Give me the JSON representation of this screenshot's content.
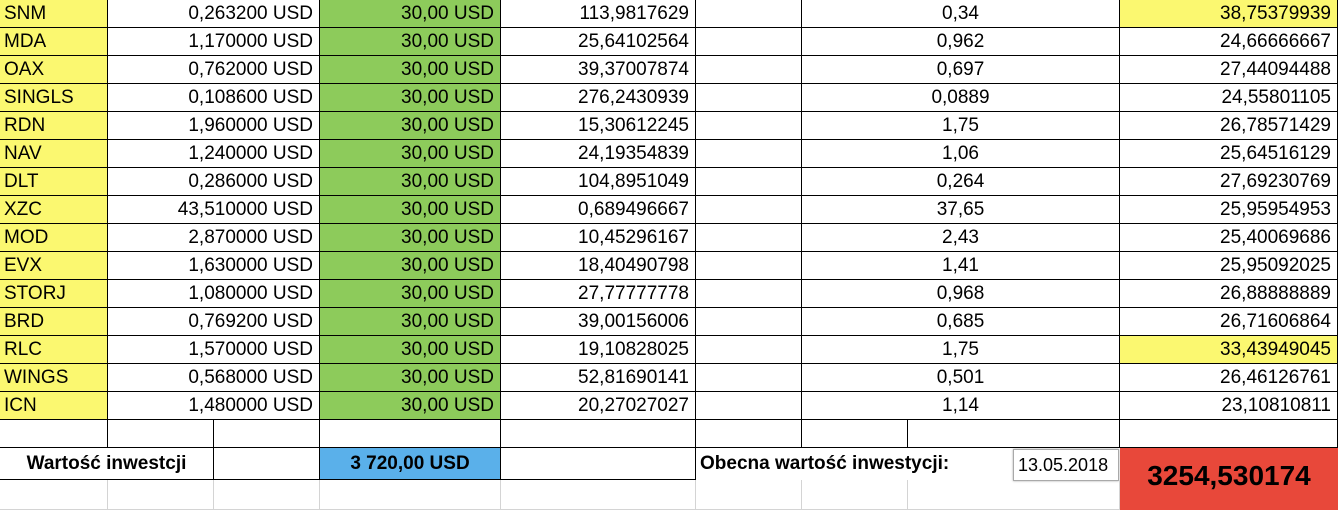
{
  "rows": [
    {
      "ticker": "SNM",
      "price": "0,263200 USD",
      "invest": "30,00 USD",
      "amount": "113,9817629",
      "current_price": "0,34",
      "current_value": "38,75379939",
      "highlight": true
    },
    {
      "ticker": "MDA",
      "price": "1,170000 USD",
      "invest": "30,00 USD",
      "amount": "25,64102564",
      "current_price": "0,962",
      "current_value": "24,66666667",
      "highlight": false
    },
    {
      "ticker": "OAX",
      "price": "0,762000 USD",
      "invest": "30,00 USD",
      "amount": "39,37007874",
      "current_price": "0,697",
      "current_value": "27,44094488",
      "highlight": false
    },
    {
      "ticker": "SINGLS",
      "price": "0,108600 USD",
      "invest": "30,00 USD",
      "amount": "276,2430939",
      "current_price": "0,0889",
      "current_value": "24,55801105",
      "highlight": false
    },
    {
      "ticker": "RDN",
      "price": "1,960000 USD",
      "invest": "30,00 USD",
      "amount": "15,30612245",
      "current_price": "1,75",
      "current_value": "26,78571429",
      "highlight": false
    },
    {
      "ticker": "NAV",
      "price": "1,240000 USD",
      "invest": "30,00 USD",
      "amount": "24,19354839",
      "current_price": "1,06",
      "current_value": "25,64516129",
      "highlight": false
    },
    {
      "ticker": "DLT",
      "price": "0,286000 USD",
      "invest": "30,00 USD",
      "amount": "104,8951049",
      "current_price": "0,264",
      "current_value": "27,69230769",
      "highlight": false
    },
    {
      "ticker": "XZC",
      "price": "43,510000 USD",
      "invest": "30,00 USD",
      "amount": "0,689496667",
      "current_price": "37,65",
      "current_value": "25,95954953",
      "highlight": false
    },
    {
      "ticker": "MOD",
      "price": "2,870000 USD",
      "invest": "30,00 USD",
      "amount": "10,45296167",
      "current_price": "2,43",
      "current_value": "25,40069686",
      "highlight": false
    },
    {
      "ticker": "EVX",
      "price": "1,630000 USD",
      "invest": "30,00 USD",
      "amount": "18,40490798",
      "current_price": "1,41",
      "current_value": "25,95092025",
      "highlight": false
    },
    {
      "ticker": "STORJ",
      "price": "1,080000 USD",
      "invest": "30,00 USD",
      "amount": "27,77777778",
      "current_price": "0,968",
      "current_value": "26,88888889",
      "highlight": false
    },
    {
      "ticker": "BRD",
      "price": "0,769200 USD",
      "invest": "30,00 USD",
      "amount": "39,00156006",
      "current_price": "0,685",
      "current_value": "26,71606864",
      "highlight": false
    },
    {
      "ticker": "RLC",
      "price": "1,570000 USD",
      "invest": "30,00 USD",
      "amount": "19,10828025",
      "current_price": "1,75",
      "current_value": "33,43949045",
      "highlight": true
    },
    {
      "ticker": "WINGS",
      "price": "0,568000 USD",
      "invest": "30,00 USD",
      "amount": "52,81690141",
      "current_price": "0,501",
      "current_value": "26,46126761",
      "highlight": false
    },
    {
      "ticker": "ICN",
      "price": "1,480000 USD",
      "invest": "30,00 USD",
      "amount": "20,27027027",
      "current_price": "1,14",
      "current_value": "23,10810811",
      "highlight": false
    }
  ],
  "summary": {
    "invest_label": "Wartość inwestcji",
    "invest_total": "3 720,00 USD",
    "current_label": "Obecna wartość inwestycji:",
    "date": "13.05.2018",
    "current_total": "3254,530174"
  },
  "colors": {
    "ticker_bg": "#fbf870",
    "invest_bg": "#8dcb5b",
    "total_bg": "#5ab0ea",
    "current_total_bg": "#e8483a",
    "highlight_bg": "#fbf870"
  }
}
